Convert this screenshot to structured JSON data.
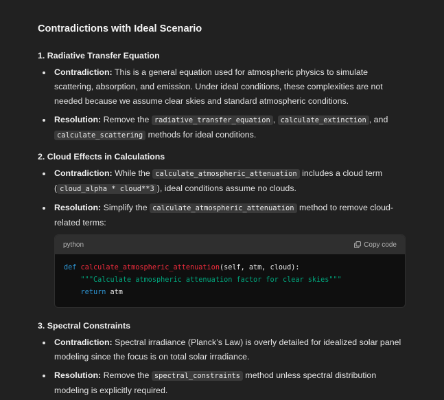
{
  "title": "Contradictions with Ideal Scenario",
  "sections": [
    {
      "heading": "1. Radiative Transfer Equation",
      "items": [
        {
          "label": "Contradiction:",
          "parts": [
            " This is a general equation used for atmospheric physics to simulate scattering, absorption, and emission. Under ideal conditions, these complexities are not needed because we assume clear skies and standard atmospheric conditions."
          ]
        },
        {
          "label": "Resolution:",
          "parts": [
            " Remove the ",
            "radiative_transfer_equation",
            ", ",
            "calculate_extinction",
            ", and ",
            "calculate_scattering",
            " methods for ideal conditions."
          ]
        }
      ]
    },
    {
      "heading": "2. Cloud Effects in Calculations",
      "items": [
        {
          "label": "Contradiction:",
          "parts": [
            " While the ",
            "calculate_atmospheric_attenuation",
            " includes a cloud term (",
            "cloud_alpha * cloud**3",
            "), ideal conditions assume no clouds."
          ]
        },
        {
          "label": "Resolution:",
          "parts": [
            " Simplify the ",
            "calculate_atmospheric_attenuation",
            " method to remove cloud-related terms:"
          ]
        }
      ],
      "code": {
        "language": "python",
        "copy_label": "Copy code",
        "line1": {
          "kw": "def ",
          "fn": "calculate_atmospheric_attenuation",
          "rest": "(self, atm, cloud):"
        },
        "line2": {
          "indent": "    ",
          "str": "\"\"\"Calculate atmospheric attenuation factor for clear skies\"\"\""
        },
        "line3": {
          "indent": "    ",
          "kw": "return",
          "rest": " atm"
        }
      }
    },
    {
      "heading": "3. Spectral Constraints",
      "items": [
        {
          "label": "Contradiction:",
          "parts": [
            " Spectral irradiance (Planck’s Law) is overly detailed for idealized solar panel modeling since the focus is on total solar irradiance."
          ]
        },
        {
          "label": "Resolution:",
          "parts": [
            " Remove the ",
            "spectral_constraints",
            " method unless spectral distribution modeling is explicitly required."
          ]
        }
      ]
    }
  ],
  "icons": {
    "copy": "copy-icon"
  },
  "colors": {
    "background": "#212121",
    "code_keyword": "#2e95d3",
    "code_function": "#f22c3d",
    "code_string": "#00a67d"
  }
}
